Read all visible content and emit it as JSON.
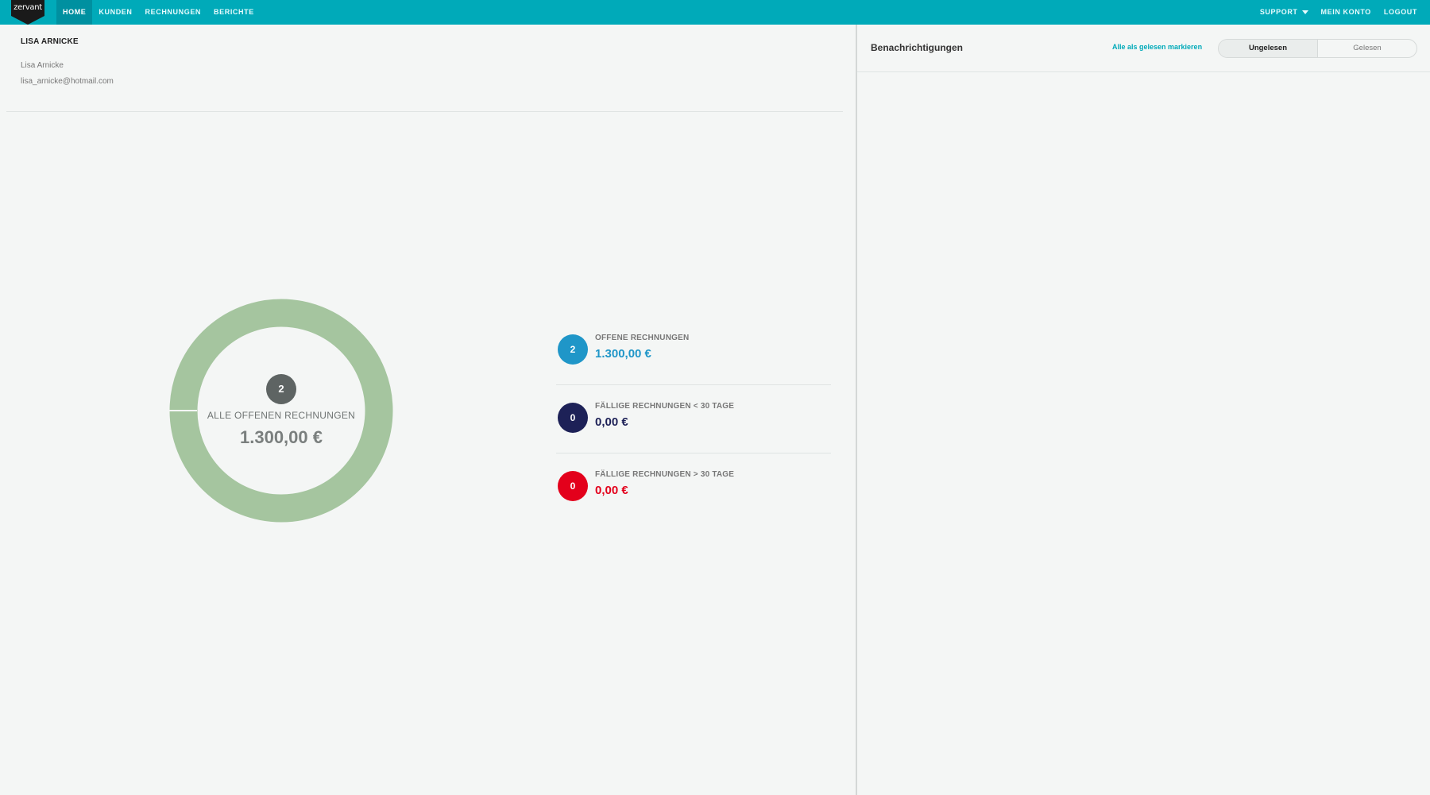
{
  "brand": {
    "name": "zervant"
  },
  "nav": {
    "left": [
      {
        "label": "HOME",
        "active": true
      },
      {
        "label": "KUNDEN",
        "active": false
      },
      {
        "label": "RECHNUNGEN",
        "active": false
      },
      {
        "label": "BERICHTE",
        "active": false
      }
    ],
    "right": {
      "support": "SUPPORT",
      "account": "MEIN KONTO",
      "logout": "LOGOUT"
    }
  },
  "customer": {
    "heading": "LISA ARNICKE",
    "contact_name": "Lisa Arnicke",
    "email": "lisa_arnicke@hotmail.com"
  },
  "donut": {
    "count": "2",
    "label": "ALLE OFFENEN RECHNUNGEN",
    "value": "1.300,00 €",
    "fill_fraction": 1.0,
    "color": "#a5c59f"
  },
  "summary": [
    {
      "count": "2",
      "label": "OFFENE RECHNUNGEN",
      "value": "1.300,00 €",
      "color": "#1f96c8"
    },
    {
      "count": "0",
      "label": "FÄLLIGE RECHNUNGEN < 30 TAGE",
      "value": "0,00 €",
      "color": "#1d2157"
    },
    {
      "count": "0",
      "label": "FÄLLIGE RECHNUNGEN > 30 TAGE",
      "value": "0,00 €",
      "color": "#e3001b"
    }
  ],
  "notifications": {
    "title": "Benachrichtigungen",
    "mark_all_read": "Alle als gelesen markieren",
    "tabs": [
      {
        "label": "Ungelesen",
        "active": true
      },
      {
        "label": "Gelesen",
        "active": false
      }
    ]
  },
  "colors": {
    "topbar": "#00aab9",
    "accent": "#00aab9"
  }
}
